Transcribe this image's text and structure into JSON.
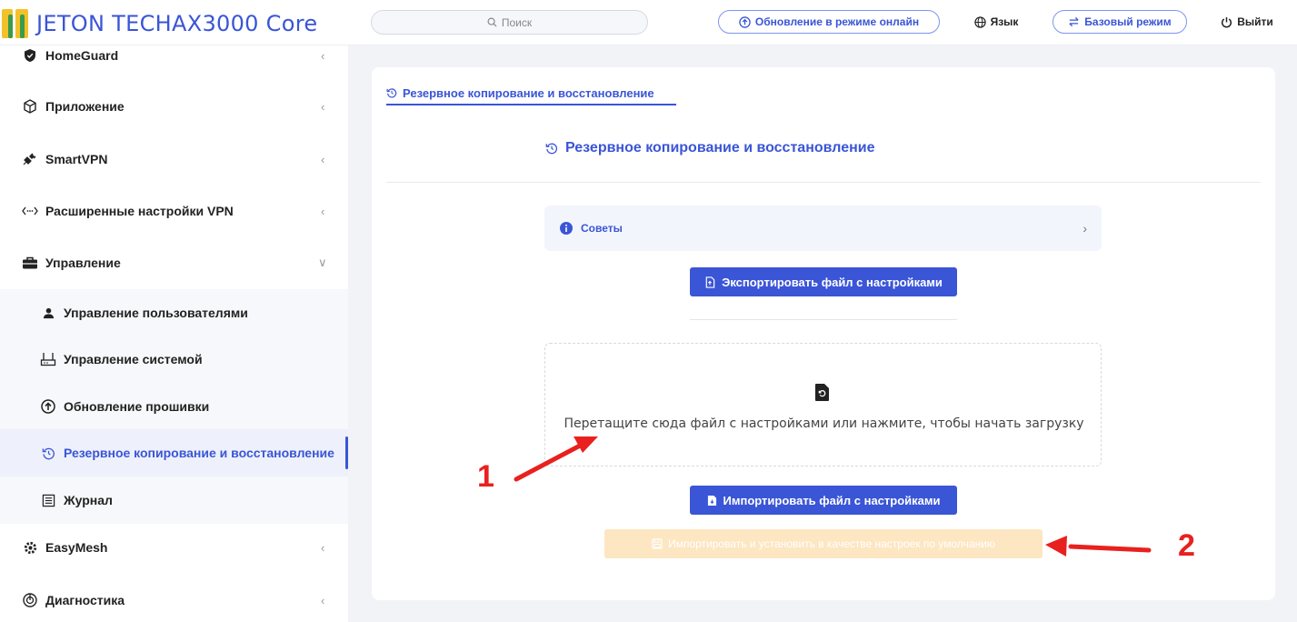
{
  "header": {
    "brand": "JETON TECH",
    "model": "AX3000 Core",
    "search_placeholder": "Поиск",
    "online_update": "Обновление в режиме онлайн",
    "language": "Язык",
    "basic_mode": "Базовый режим",
    "logout": "Выйти"
  },
  "sidebar": {
    "items": [
      {
        "label": "HomeGuard"
      },
      {
        "label": "Приложение"
      },
      {
        "label": "SmartVPN"
      },
      {
        "label": "Расширенные настройки VPN"
      },
      {
        "label": "Управление"
      },
      {
        "label": "EasyMesh"
      },
      {
        "label": "Диагностика"
      }
    ],
    "sub_items": [
      {
        "label": "Управление пользователями"
      },
      {
        "label": "Управление системой"
      },
      {
        "label": "Обновление прошивки"
      },
      {
        "label": "Резервное копирование и восстановление"
      },
      {
        "label": "Журнал"
      }
    ]
  },
  "main": {
    "tab_label": "Резервное копирование и восстановление",
    "section_title": "Резервное копирование и восстановление",
    "tips_label": "Советы",
    "export_button": "Экспортировать файл с настройками",
    "dropzone_text": "Перетащите сюда файл с настройками или нажмите, чтобы начать загрузку",
    "import_button": "Импортировать файл с настройками",
    "import_default_button": "Импортировать и установить в качестве настроек по умолчанию"
  },
  "annotations": {
    "marker_1": "1",
    "marker_2": "2"
  },
  "colors": {
    "accent": "#3a55d6",
    "annotation": "#e8211e",
    "disabled_button": "#fde6c2"
  }
}
